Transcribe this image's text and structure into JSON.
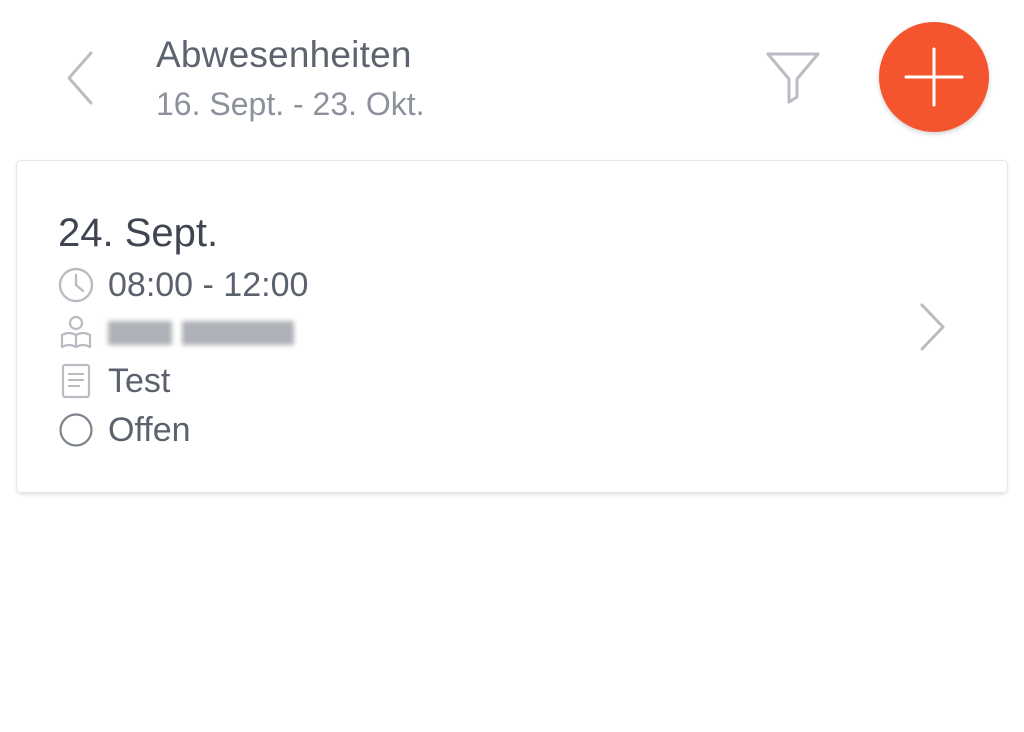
{
  "header": {
    "title": "Abwesenheiten",
    "subtitle": "16. Sept. - 23. Okt.",
    "back_icon": "chevron-left-icon",
    "filter_icon": "filter-icon",
    "add_icon": "plus-icon"
  },
  "colors": {
    "accent": "#f4552e",
    "icon_gray": "#b9bdc3",
    "text_dark": "#3f4652",
    "text_muted": "#8c929c"
  },
  "absences": [
    {
      "date": "24. Sept.",
      "time": "08:00 - 12:00",
      "person_name_blurred": true,
      "note": "Test",
      "status": "Offen"
    }
  ]
}
